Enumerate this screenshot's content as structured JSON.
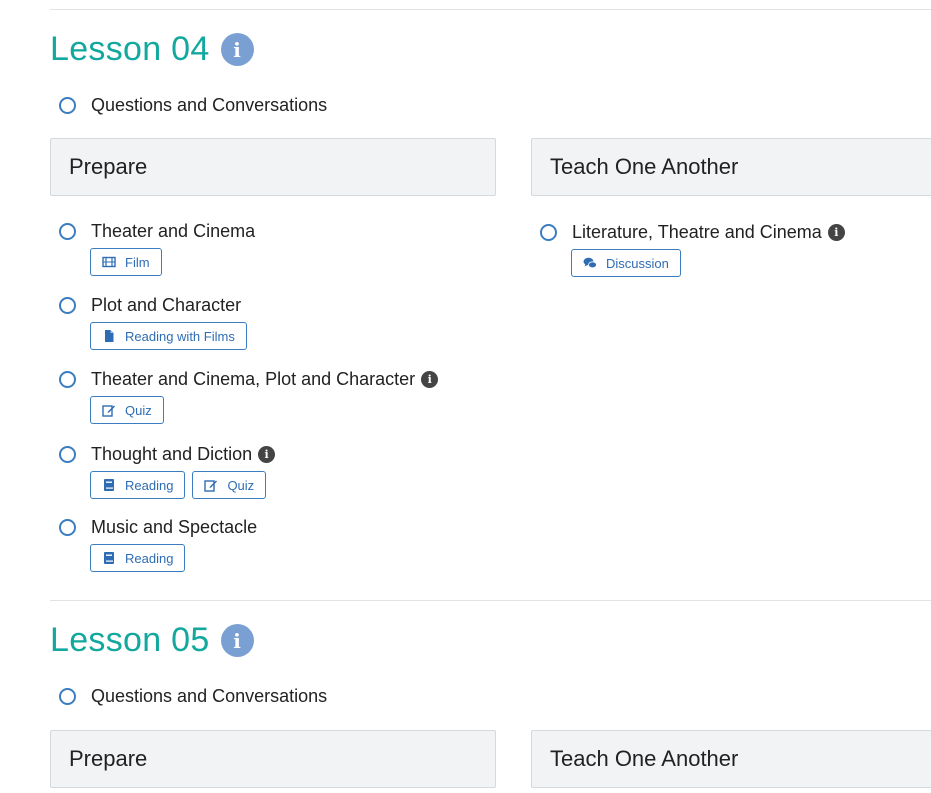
{
  "lessons": [
    {
      "title": "Lesson 04",
      "intro_item": "Questions and Conversations",
      "prepare": {
        "header": "Prepare",
        "items": [
          {
            "label": "Theater and Cinema",
            "info": false,
            "chips": [
              {
                "icon": "film-icon",
                "label": "Film"
              }
            ]
          },
          {
            "label": "Plot and Character",
            "info": false,
            "chips": [
              {
                "icon": "file-icon",
                "label": "Reading with Films"
              }
            ]
          },
          {
            "label": "Theater and Cinema, Plot and Character",
            "info": true,
            "chips": [
              {
                "icon": "edit-icon",
                "label": "Quiz"
              }
            ]
          },
          {
            "label": "Thought and Diction",
            "info": true,
            "chips": [
              {
                "icon": "book-icon",
                "label": "Reading"
              },
              {
                "icon": "edit-icon",
                "label": "Quiz"
              }
            ]
          },
          {
            "label": "Music and Spectacle",
            "info": false,
            "chips": [
              {
                "icon": "book-icon",
                "label": "Reading"
              }
            ]
          }
        ]
      },
      "teach": {
        "header": "Teach One Another",
        "items": [
          {
            "label": "Literature, Theatre and Cinema",
            "info": true,
            "chips": [
              {
                "icon": "comments-icon",
                "label": "Discussion"
              }
            ]
          }
        ]
      }
    },
    {
      "title": "Lesson 05",
      "intro_item": "Questions and Conversations",
      "prepare": {
        "header": "Prepare"
      },
      "teach": {
        "header": "Teach One Another"
      }
    }
  ],
  "colors": {
    "lesson_title": "#13a89e",
    "big_info_icon": "#7a9fd3",
    "link_blue": "#2e6db4",
    "header_bg": "#f2f3f4"
  }
}
